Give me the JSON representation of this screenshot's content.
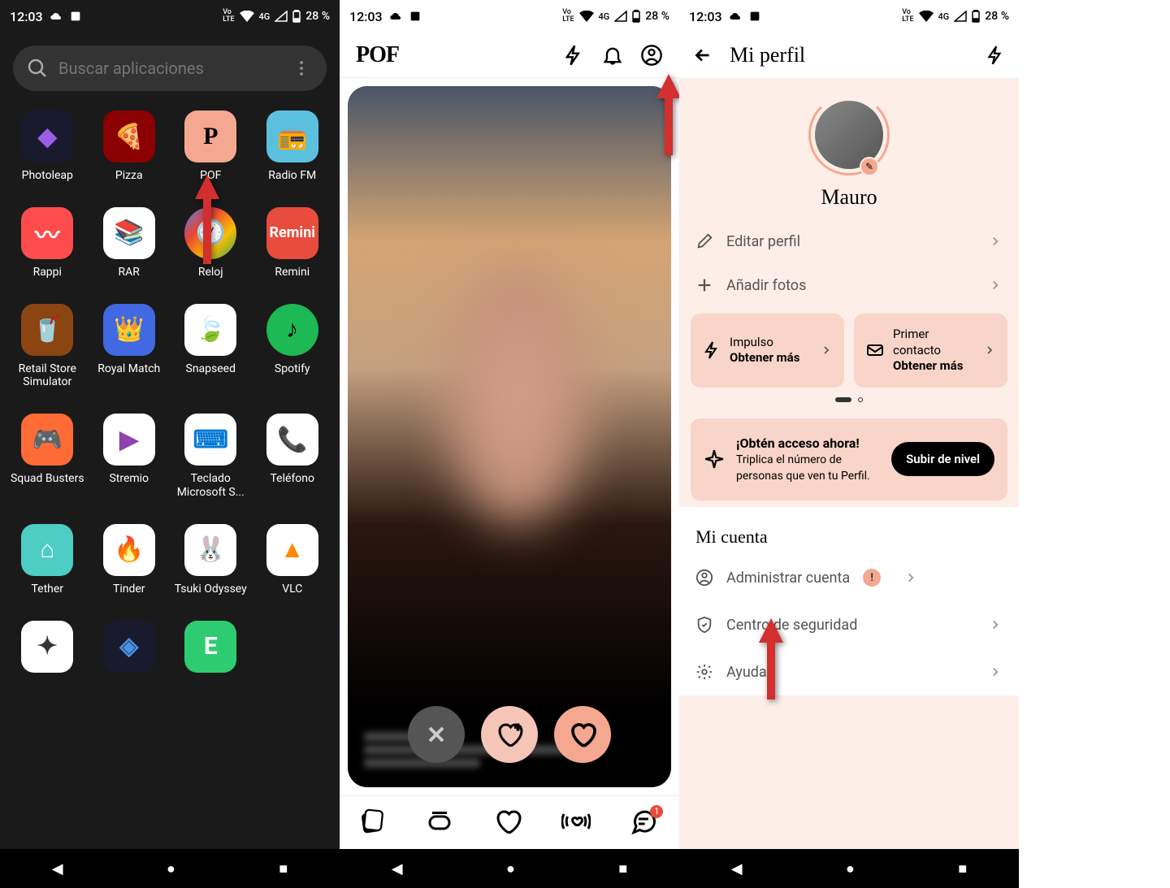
{
  "statusBar": {
    "time": "12:03",
    "battery": "28 %",
    "network": "4G"
  },
  "phone1": {
    "searchPlaceholder": "Buscar aplicaciones",
    "apps": [
      {
        "name": "Photoleap"
      },
      {
        "name": "Pizza"
      },
      {
        "name": "POF"
      },
      {
        "name": "Radio FM"
      },
      {
        "name": "Rappi"
      },
      {
        "name": "RAR"
      },
      {
        "name": "Reloj"
      },
      {
        "name": "Remini"
      },
      {
        "name": "Retail Store Simulator"
      },
      {
        "name": "Royal Match"
      },
      {
        "name": "Snapseed"
      },
      {
        "name": "Spotify"
      },
      {
        "name": "Squad Busters"
      },
      {
        "name": "Stremio"
      },
      {
        "name": "Teclado Microsoft S..."
      },
      {
        "name": "Teléfono"
      },
      {
        "name": "Tether"
      },
      {
        "name": "Tinder"
      },
      {
        "name": "Tsuki Odyssey"
      },
      {
        "name": "VLC"
      }
    ]
  },
  "phone2": {
    "logo": "POF",
    "navBadge": "1"
  },
  "phone3": {
    "title": "Mi perfil",
    "userName": "Mauro",
    "editProfile": "Editar perfil",
    "addPhotos": "Añadir fotos",
    "promo1Title": "Impulso",
    "promo1Action": "Obtener más",
    "promo2Title": "Primer contacto",
    "promo2Action": "Obtener más",
    "upgradeTitle": "¡Obtén acceso ahora!",
    "upgradeDesc": "Triplica el número de personas que ven tu Perfil.",
    "upgradeBtn": "Subir de nivel",
    "sectionAccount": "Mi cuenta",
    "manageAccount": "Administrar cuenta",
    "securityCenter": "Centro de seguridad",
    "help": "Ayuda"
  }
}
